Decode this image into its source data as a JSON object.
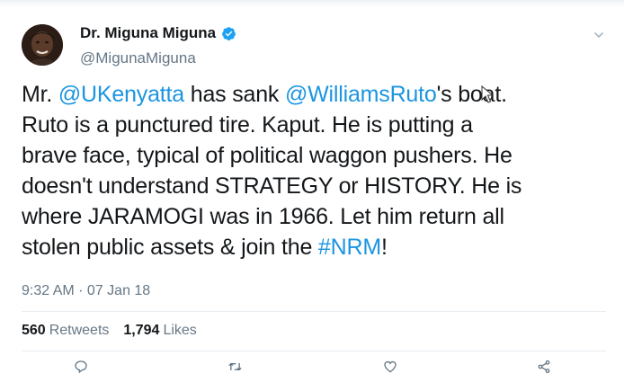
{
  "tweet": {
    "author": {
      "display_name": "Dr. Miguna Miguna",
      "handle": "@MigunaMiguna",
      "verified": true,
      "avatar_icon": "user-avatar-photo"
    },
    "text_lines": [
      [
        {
          "t": "Mr. "
        },
        {
          "t": "@UKenyatta",
          "mention": true
        },
        {
          "t": " has sank "
        },
        {
          "t": "@WilliamsRuto",
          "mention": true
        },
        {
          "t": "'s boat."
        }
      ],
      [
        {
          "t": "Ruto is a punctured tire. Kaput.  He is putting a"
        }
      ],
      [
        {
          "t": "brave face, typical of political waggon pushers. He"
        }
      ],
      [
        {
          "t": "doesn't understand STRATEGY or HISTORY. He is"
        }
      ],
      [
        {
          "t": "where JARAMOGI was in 1966. Let him return all"
        }
      ],
      [
        {
          "t": "stolen public assets & join the "
        },
        {
          "t": "#NRM",
          "hashtag": true
        },
        {
          "t": "!"
        }
      ]
    ],
    "timestamp": "9:32 AM · 07 Jan 18",
    "stats": {
      "retweets_count": "560",
      "retweets_label": "Retweets",
      "likes_count": "1,794",
      "likes_label": "Likes"
    },
    "actions": [
      {
        "name": "reply",
        "icon": "reply-icon"
      },
      {
        "name": "retweet",
        "icon": "retweet-icon"
      },
      {
        "name": "like",
        "icon": "heart-icon"
      },
      {
        "name": "share",
        "icon": "share-icon"
      }
    ]
  },
  "colors": {
    "link": "#1b95e0",
    "text": "#14171a",
    "secondary": "#657786",
    "divider": "#e6ecf0",
    "verified": "#1da1f2"
  }
}
